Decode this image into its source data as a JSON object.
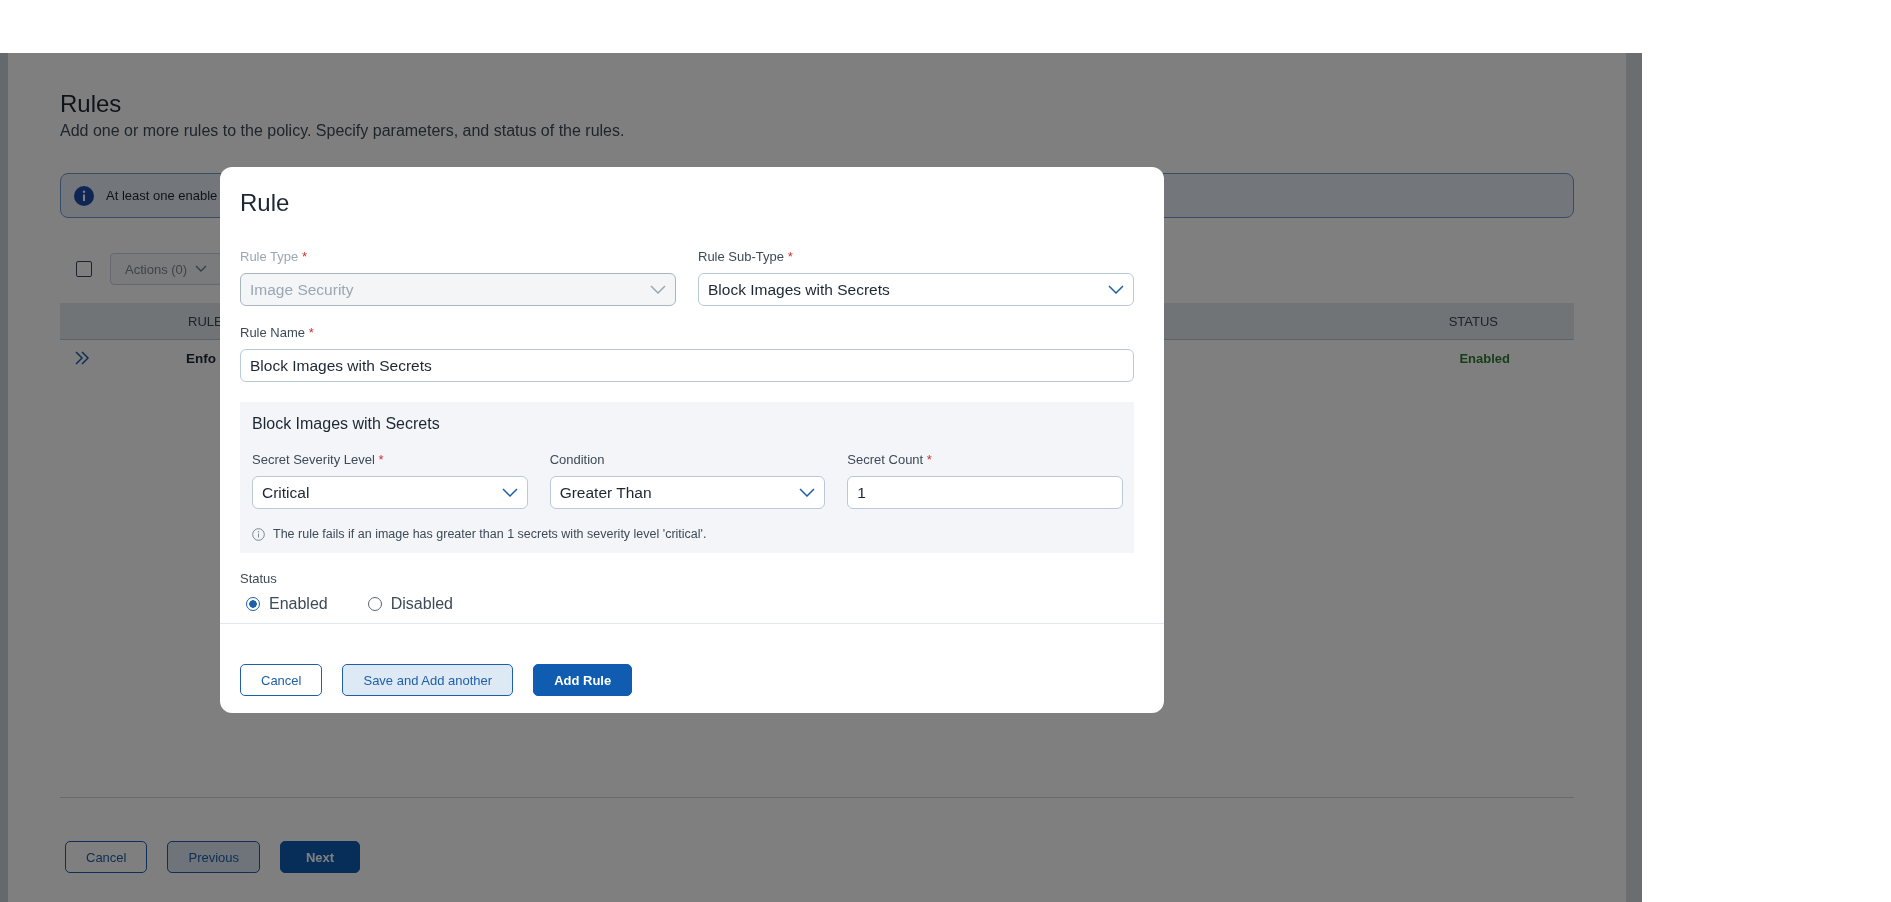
{
  "page": {
    "title": "Rules",
    "subtitle": "Add one or more rules to the policy. Specify parameters, and status of the rules.",
    "banner": {
      "text": "At least one enable"
    },
    "toolbar": {
      "select_all": {
        "checked": false
      },
      "actions": "Actions (0)"
    },
    "table": {
      "columns": [
        "RULE",
        "STATUS"
      ],
      "rows": [
        {
          "rule": "Enfo",
          "status": "Enabled"
        }
      ]
    },
    "buttons": [
      {
        "label": "Cancel",
        "kind": "outline"
      },
      {
        "label": "Previous",
        "kind": "secondary"
      },
      {
        "label": "Next",
        "kind": "primary"
      }
    ]
  },
  "modal": {
    "title": "Rule",
    "fields": [
      {
        "kind": "select",
        "label": "Rule Type",
        "marker": "*",
        "value": "Image Security",
        "disabled": true
      },
      {
        "kind": "select",
        "label": "Rule Sub-Type",
        "marker": "*",
        "value": "Block Images with Secrets",
        "disabled": false
      },
      {
        "kind": "text",
        "label": "Rule Name",
        "marker": "*",
        "value": "Block Images with Secrets",
        "disabled": false
      }
    ],
    "section": {
      "title": "Block Images with Secrets",
      "fields": [
        {
          "kind": "select",
          "label": "Secret Severity Level",
          "marker": "*",
          "value": "Critical",
          "disabled": false
        },
        {
          "kind": "select",
          "label": "Condition",
          "value": "Greater Than",
          "disabled": false
        },
        {
          "kind": "text",
          "label": "Secret Count",
          "marker": "*",
          "value": "1",
          "disabled": false
        }
      ],
      "hint": "The rule fails if an image has greater than 1 secrets with severity level 'critical'."
    },
    "status": {
      "label": "Status",
      "options": [
        {
          "label": "Enabled",
          "selected": true
        },
        {
          "label": "Disabled",
          "selected": false
        }
      ]
    },
    "buttons": [
      {
        "label": "Cancel",
        "kind": "outline"
      },
      {
        "label": "Save and Add another",
        "kind": "secondary"
      },
      {
        "label": "Add Rule",
        "kind": "primary"
      }
    ]
  }
}
